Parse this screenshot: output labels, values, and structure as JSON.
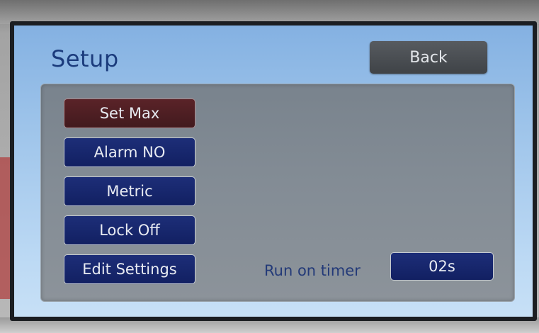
{
  "screen": {
    "title": "Setup",
    "back_label": "Back"
  },
  "menu": {
    "items": [
      {
        "label": "Set Max",
        "selected": true
      },
      {
        "label": "Alarm NO",
        "selected": false
      },
      {
        "label": "Metric",
        "selected": false
      },
      {
        "label": "Lock Off",
        "selected": false
      },
      {
        "label": "Edit Settings",
        "selected": false
      }
    ]
  },
  "run_on_timer": {
    "label": "Run on timer",
    "value": "02s"
  },
  "colors": {
    "button_blue": "#1d2e78",
    "button_selected": "#5a2328",
    "back_button": "#4a4e53",
    "title_text": "#1b3b7c",
    "panel": "#838c95"
  }
}
